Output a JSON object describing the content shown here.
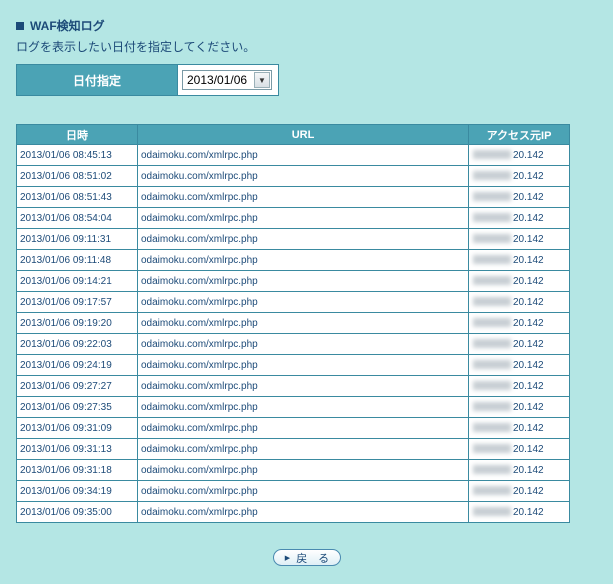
{
  "header": {
    "title": "WAF検知ログ",
    "subtitle": "ログを表示したい日付を指定してください。"
  },
  "date_filter": {
    "label": "日付指定",
    "selected": "2013/01/06"
  },
  "table": {
    "columns": [
      "日時",
      "URL",
      "アクセス元IP"
    ],
    "rows": [
      {
        "datetime": "2013/01/06 08:45:13",
        "url": "odaimoku.com/xmlrpc.php",
        "ip": "20.142"
      },
      {
        "datetime": "2013/01/06 08:51:02",
        "url": "odaimoku.com/xmlrpc.php",
        "ip": "20.142"
      },
      {
        "datetime": "2013/01/06 08:51:43",
        "url": "odaimoku.com/xmlrpc.php",
        "ip": "20.142"
      },
      {
        "datetime": "2013/01/06 08:54:04",
        "url": "odaimoku.com/xmlrpc.php",
        "ip": "20.142"
      },
      {
        "datetime": "2013/01/06 09:11:31",
        "url": "odaimoku.com/xmlrpc.php",
        "ip": "20.142"
      },
      {
        "datetime": "2013/01/06 09:11:48",
        "url": "odaimoku.com/xmlrpc.php",
        "ip": "20.142"
      },
      {
        "datetime": "2013/01/06 09:14:21",
        "url": "odaimoku.com/xmlrpc.php",
        "ip": "20.142"
      },
      {
        "datetime": "2013/01/06 09:17:57",
        "url": "odaimoku.com/xmlrpc.php",
        "ip": "20.142"
      },
      {
        "datetime": "2013/01/06 09:19:20",
        "url": "odaimoku.com/xmlrpc.php",
        "ip": "20.142"
      },
      {
        "datetime": "2013/01/06 09:22:03",
        "url": "odaimoku.com/xmlrpc.php",
        "ip": "20.142"
      },
      {
        "datetime": "2013/01/06 09:24:19",
        "url": "odaimoku.com/xmlrpc.php",
        "ip": "20.142"
      },
      {
        "datetime": "2013/01/06 09:27:27",
        "url": "odaimoku.com/xmlrpc.php",
        "ip": "20.142"
      },
      {
        "datetime": "2013/01/06 09:27:35",
        "url": "odaimoku.com/xmlrpc.php",
        "ip": "20.142"
      },
      {
        "datetime": "2013/01/06 09:31:09",
        "url": "odaimoku.com/xmlrpc.php",
        "ip": "20.142"
      },
      {
        "datetime": "2013/01/06 09:31:13",
        "url": "odaimoku.com/xmlrpc.php",
        "ip": "20.142"
      },
      {
        "datetime": "2013/01/06 09:31:18",
        "url": "odaimoku.com/xmlrpc.php",
        "ip": "20.142"
      },
      {
        "datetime": "2013/01/06 09:34:19",
        "url": "odaimoku.com/xmlrpc.php",
        "ip": "20.142"
      },
      {
        "datetime": "2013/01/06 09:35:00",
        "url": "odaimoku.com/xmlrpc.php",
        "ip": "20.142"
      }
    ]
  },
  "footer": {
    "back_label": "戻　る"
  },
  "colors": {
    "background": "#b4e6e4",
    "header_fill": "#4ba3b5",
    "text": "#1c4a78"
  },
  "icons": {
    "title_bullet": "square-bullet-icon",
    "select_arrow": "chevron-down-icon",
    "back_arrow": "triangle-right-icon"
  }
}
